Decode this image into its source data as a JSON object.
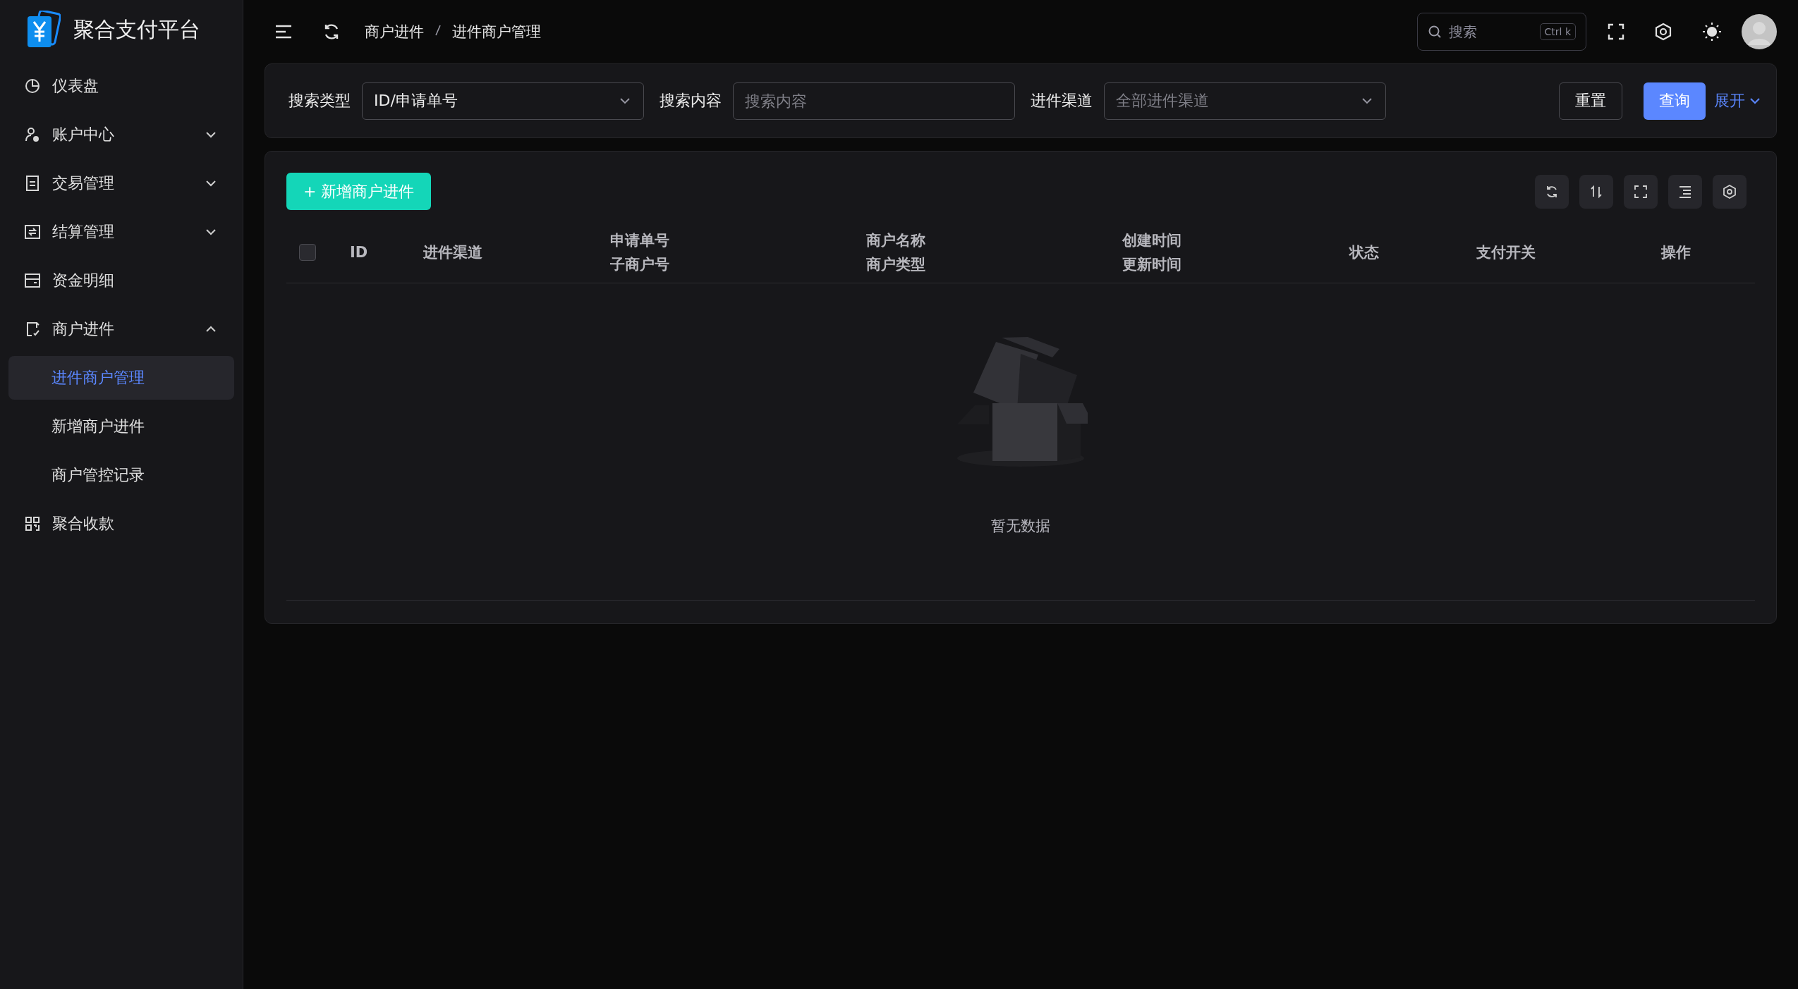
{
  "app": {
    "title": "聚合支付平台"
  },
  "sidebar": {
    "items": [
      {
        "label": "仪表盘",
        "selected": false
      },
      {
        "label": "账户中心",
        "selected": false,
        "expanded": false
      },
      {
        "label": "交易管理",
        "selected": false,
        "expanded": false
      },
      {
        "label": "结算管理",
        "selected": false,
        "expanded": false
      },
      {
        "label": "资金明细",
        "selected": false
      },
      {
        "label": "商户进件",
        "selected": false,
        "expanded": true,
        "children": [
          {
            "label": "进件商户管理",
            "selected": true
          },
          {
            "label": "新增商户进件",
            "selected": false
          },
          {
            "label": "商户管控记录",
            "selected": false
          }
        ]
      },
      {
        "label": "聚合收款",
        "selected": false
      }
    ]
  },
  "header": {
    "breadcrumb": [
      "商户进件",
      "进件商户管理"
    ],
    "search": {
      "placeholder": "搜索",
      "shortcut": "Ctrl k"
    }
  },
  "filters": {
    "fields": [
      {
        "kind": "select",
        "label": "搜索类型",
        "value": "ID/申请单号"
      },
      {
        "kind": "input",
        "label": "搜索内容",
        "placeholder": "搜索内容"
      },
      {
        "kind": "select",
        "label": "进件渠道",
        "placeholder": "全部进件渠道"
      }
    ],
    "reset": "重置",
    "query": "查询",
    "expand": "展开"
  },
  "table": {
    "add_button": "+ 新增商户进件",
    "select_all": {
      "checked": false
    },
    "columns": [
      {
        "lines": [
          "ID"
        ]
      },
      {
        "lines": [
          "进件渠道"
        ]
      },
      {
        "lines": [
          "申请单号",
          "子商户号"
        ]
      },
      {
        "lines": [
          "商户名称",
          "商户类型"
        ]
      },
      {
        "lines": [
          "创建时间",
          "更新时间"
        ]
      },
      {
        "lines": [
          "状态"
        ]
      },
      {
        "lines": [
          "支付开关"
        ]
      },
      {
        "lines": [
          "操作"
        ]
      }
    ],
    "empty_text": "暂无数据"
  }
}
